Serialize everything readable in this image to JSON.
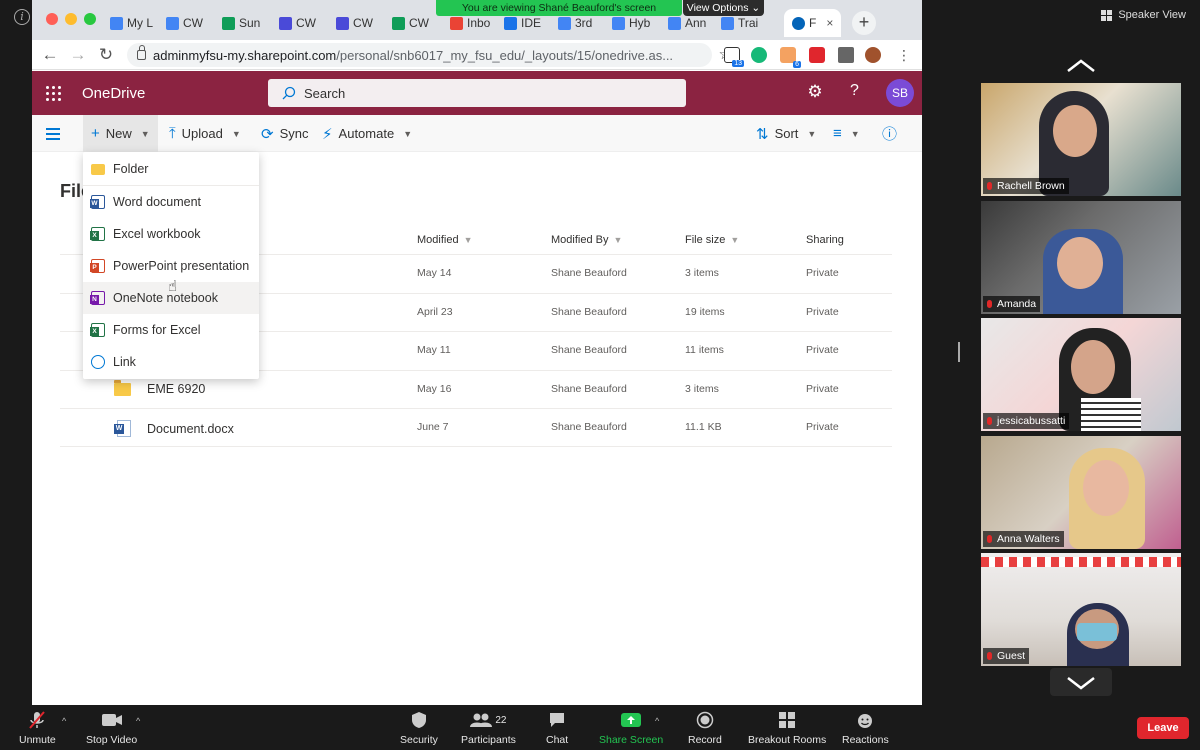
{
  "zoom": {
    "banner": "You are viewing Shané Beauford's screen",
    "view_options": "View Options",
    "speaker_view": "Speaker View",
    "leave": "Leave",
    "participants_count": "22",
    "toolbar": {
      "unmute": "Unmute",
      "stop_video": "Stop Video",
      "security": "Security",
      "participants": "Participants",
      "chat": "Chat",
      "share_screen": "Share Screen",
      "record": "Record",
      "breakout_rooms": "Breakout Rooms",
      "reactions": "Reactions"
    },
    "gallery": [
      {
        "name": "Rachell Brown"
      },
      {
        "name": "Amanda"
      },
      {
        "name": "jessicabussatti"
      },
      {
        "name": "Anna Walters"
      },
      {
        "name": "Guest"
      }
    ]
  },
  "browser": {
    "tabs": [
      "My L",
      "CW",
      "Sun",
      "CW",
      "CW",
      "CW",
      "Inbo",
      "IDE",
      "3rd",
      "Hyb",
      "Ann",
      "Trai",
      "F"
    ],
    "tab_close": "×",
    "url_host": "adminmyfsu-my.sharepoint.com",
    "url_path": "/personal/snb6017_my_fsu_edu/_layouts/15/onedrive.as...",
    "ext_badges": [
      "13",
      "6"
    ],
    "colors": {
      "tab_green": "#0f9d58",
      "tab_blue": "#4285f4",
      "tab_purple": "#4a4ad8",
      "gmail_red": "#ea4335",
      "onedrive_blue": "#0364b8"
    }
  },
  "onedrive": {
    "app_title": "OneDrive",
    "search_placeholder": "Search",
    "avatar_initials": "SB",
    "help": "?",
    "brand_color": "#8b2341",
    "commands": {
      "new": "New",
      "upload": "Upload",
      "sync": "Sync",
      "automate": "Automate",
      "sort": "Sort"
    },
    "title_partial": "File",
    "columns": [
      "Modified",
      "Modified By",
      "File size",
      "Sharing"
    ],
    "rows": [
      {
        "name": "",
        "modified": "May 14",
        "by": "Shane Beauford",
        "size": "3 items",
        "sharing": "Private",
        "type": "folder"
      },
      {
        "name": "",
        "modified": "April 23",
        "by": "Shane Beauford",
        "size": "19 items",
        "sharing": "Private",
        "type": "folder"
      },
      {
        "name": "",
        "modified": "May 11",
        "by": "Shane Beauford",
        "size": "11 items",
        "sharing": "Private",
        "type": "folder"
      },
      {
        "name": "EME 6920",
        "modified": "May 16",
        "by": "Shane Beauford",
        "size": "3 items",
        "sharing": "Private",
        "type": "folder"
      },
      {
        "name": "Document.docx",
        "modified": "June 7",
        "by": "Shane Beauford",
        "size": "11.1 KB",
        "sharing": "Private",
        "type": "word"
      }
    ],
    "new_menu": [
      {
        "label": "Folder",
        "icon": "folder-icon"
      },
      {
        "label": "Word document",
        "icon": "word-icon"
      },
      {
        "label": "Excel workbook",
        "icon": "excel-icon"
      },
      {
        "label": "PowerPoint presentation",
        "icon": "powerpoint-icon"
      },
      {
        "label": "OneNote notebook",
        "icon": "onenote-icon"
      },
      {
        "label": "Forms for Excel",
        "icon": "forms-icon"
      },
      {
        "label": "Link",
        "icon": "globe-icon"
      }
    ]
  }
}
